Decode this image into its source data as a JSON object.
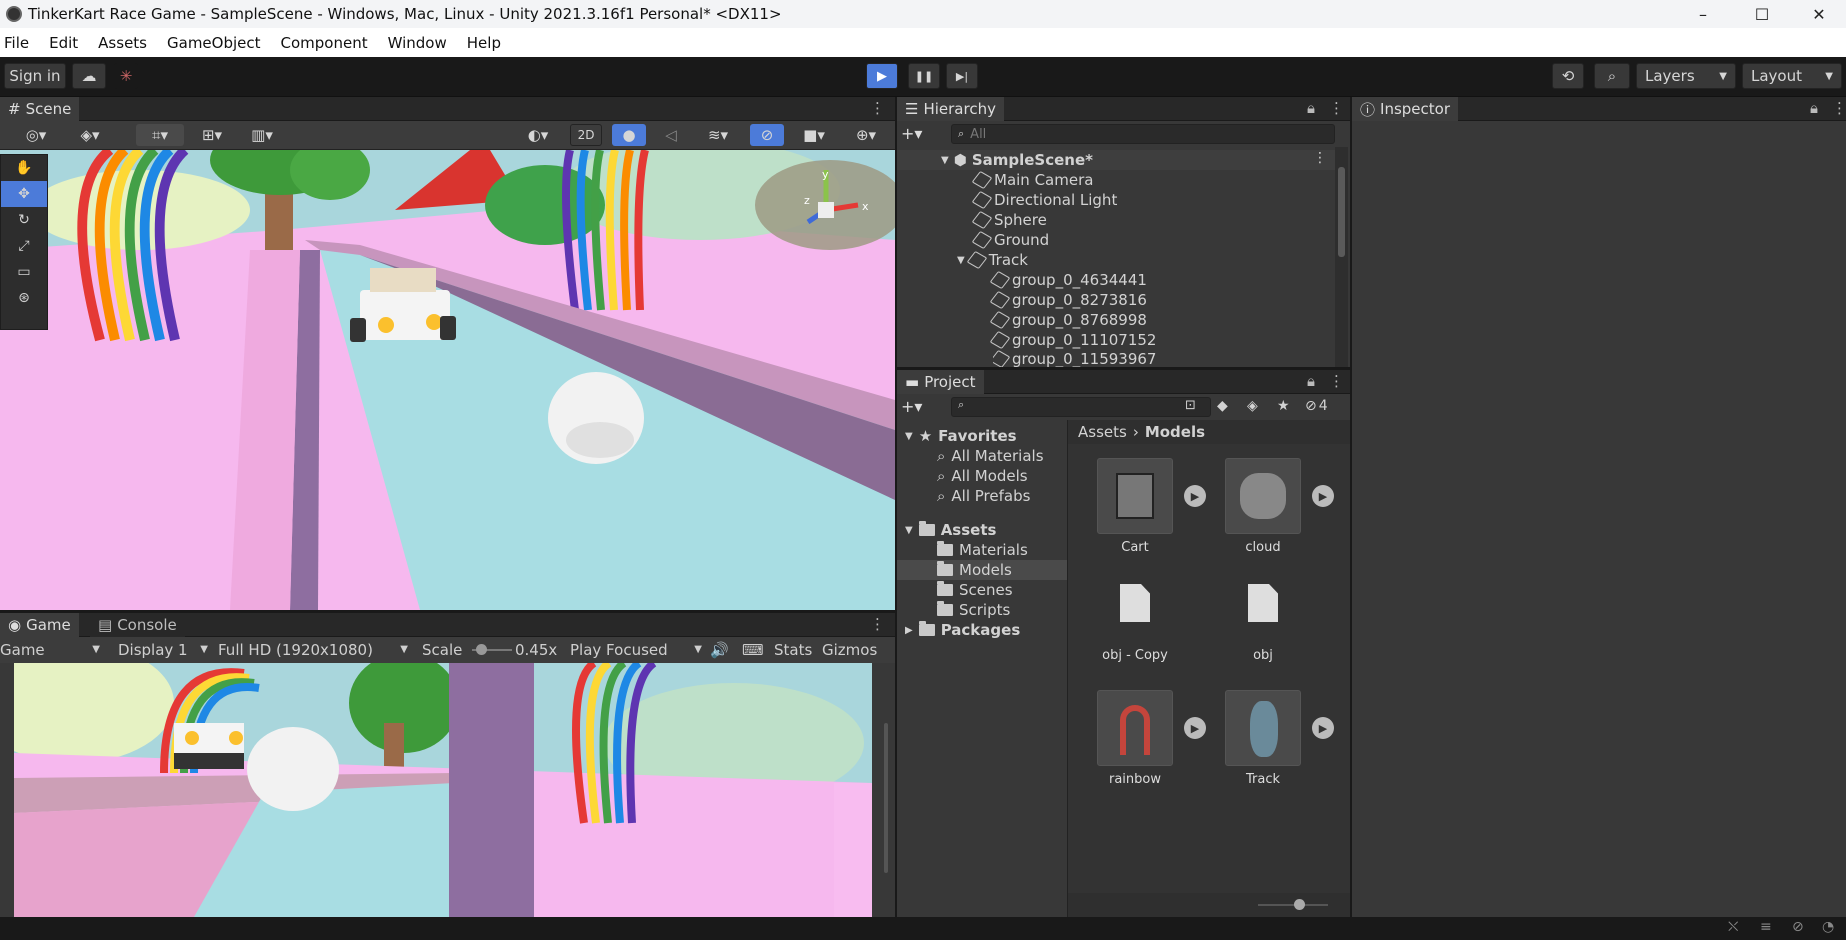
{
  "titlebar": {
    "title": "TinkerKart Race Game - SampleScene - Windows, Mac, Linux - Unity 2021.3.16f1 Personal* <DX11>",
    "minimize": "–",
    "maximize": "☐",
    "close": "✕"
  },
  "menu": [
    "File",
    "Edit",
    "Assets",
    "GameObject",
    "Component",
    "Window",
    "Help"
  ],
  "toolbar": {
    "signin": "Sign in",
    "play": "▶",
    "pause": "❚❚",
    "step": "▶|",
    "layers": "Layers",
    "layout": "Layout"
  },
  "scene": {
    "tab": "Scene",
    "mode2d": "2D"
  },
  "gizmo_axes": {
    "y": "y",
    "x": "x",
    "z": "z"
  },
  "game": {
    "tab_game": "Game",
    "tab_console": "Console",
    "view": "Game",
    "display": "Display 1",
    "resolution": "Full HD (1920x1080)",
    "scale_label": "Scale",
    "scale_value": "0.45x",
    "play_mode": "Play Focused",
    "stats": "Stats",
    "gizmos": "Gizmos"
  },
  "hierarchy": {
    "tab": "Hierarchy",
    "search_placeholder": "All",
    "scene": "SampleScene*",
    "items": [
      "Main Camera",
      "Directional Light",
      "Sphere",
      "Ground",
      "Track"
    ],
    "children": [
      "group_0_4634441",
      "group_0_8273816",
      "group_0_8768998",
      "group_0_11107152",
      "group_0_11593967"
    ]
  },
  "inspector": {
    "tab": "Inspector"
  },
  "project": {
    "tab": "Project",
    "hidden_count": "4",
    "favorites": "Favorites",
    "fav_items": [
      "All Materials",
      "All Models",
      "All Prefabs"
    ],
    "assets": "Assets",
    "asset_folders": [
      "Materials",
      "Models",
      "Scenes",
      "Scripts"
    ],
    "packages": "Packages",
    "breadcrumb": [
      "Assets",
      "Models"
    ],
    "grid": [
      "Cart",
      "cloud",
      "obj - Copy",
      "obj",
      "rainbow",
      "Track"
    ]
  },
  "colors": {
    "accent": "#4c7bd9",
    "panel": "#383838",
    "pink_ground": "#f7b8ee",
    "track": "#a8dde3"
  }
}
